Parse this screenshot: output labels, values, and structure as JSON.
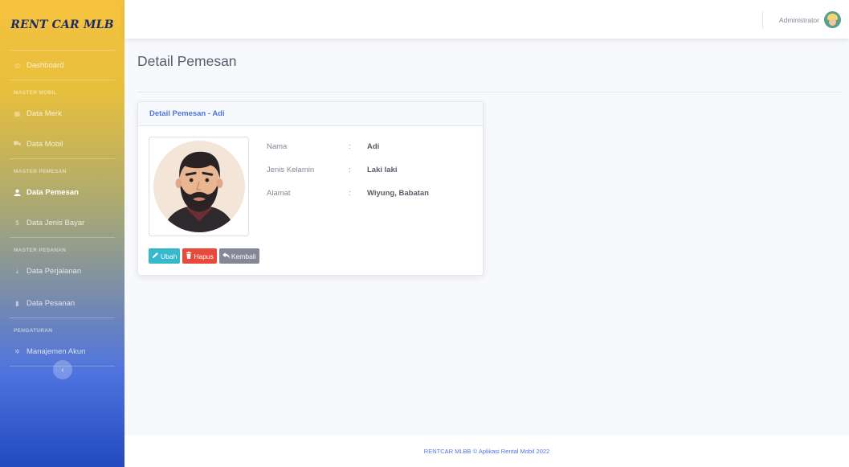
{
  "brand": "RENT CAR MLB",
  "sidebar": {
    "dashboard": "Dashboard",
    "headings": {
      "mobil": "MASTER MOBIL",
      "pemesan": "MASTER PEMESAN",
      "pesanan": "MASTER PESANAN",
      "pengaturan": "PENGATURAN"
    },
    "items": {
      "data_merk": "Data Merk",
      "data_mobil": "Data Mobil",
      "data_pemesan": "Data Pemesan",
      "data_jenis_bayar": "Data Jenis Bayar",
      "data_perjalanan": "Data Perjalanan",
      "data_pesanan": "Data Pesanan",
      "manajemen_akun": "Manajemen Akun"
    },
    "toggle": "‹"
  },
  "topbar": {
    "username": "Administrator"
  },
  "page": {
    "title": "Detail Pemesan"
  },
  "card": {
    "title": "Detail Pemesan - Adi",
    "fields": [
      {
        "label": "Nama",
        "value": "Adi"
      },
      {
        "label": "Jenis Kelamin",
        "value": "Laki laki"
      },
      {
        "label": "Alamat",
        "value": "Wiyung, Babatan"
      }
    ],
    "colon": ":",
    "buttons": {
      "edit": "Ubah",
      "delete": "Hapus",
      "back": "Kembali"
    }
  },
  "footer": "RENTCAR MLBB © Aplikasi Rental Mobil 2022",
  "colors": {
    "primary": "#4e73df",
    "info": "#36b9cc",
    "danger": "#e74a3b",
    "secondary": "#858796",
    "sidebar_top": "#f6c23e"
  }
}
